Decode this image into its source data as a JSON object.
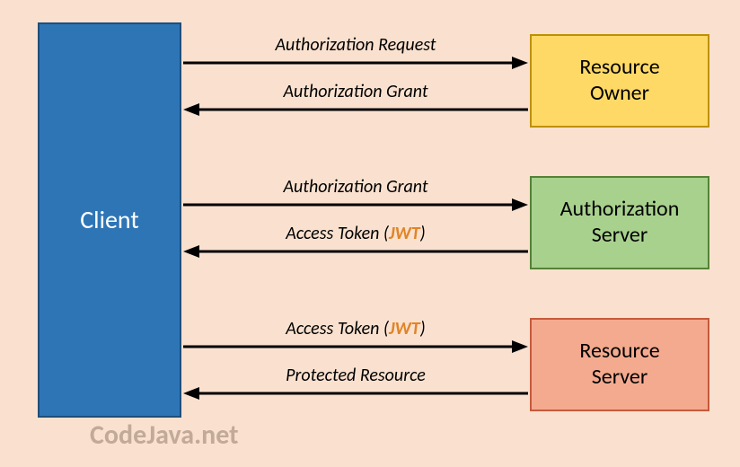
{
  "client": {
    "label": "Client"
  },
  "resource_owner": {
    "label": "Resource\nOwner"
  },
  "auth_server": {
    "label": "Authorization\nServer"
  },
  "resource_server": {
    "label": "Resource\nServer"
  },
  "arrows": {
    "auth_request": "Authorization Request",
    "auth_grant_back": "Authorization Grant",
    "auth_grant_forward": "Authorization Grant",
    "access_token_back_prefix": "Access Token (",
    "access_token_back_jwt": "JWT",
    "access_token_back_suffix": ")",
    "access_token_forward_prefix": "Access Token (",
    "access_token_forward_jwt": "JWT",
    "access_token_forward_suffix": ")",
    "protected_resource": "Protected Resource"
  },
  "watermark": "CodeJava.net"
}
